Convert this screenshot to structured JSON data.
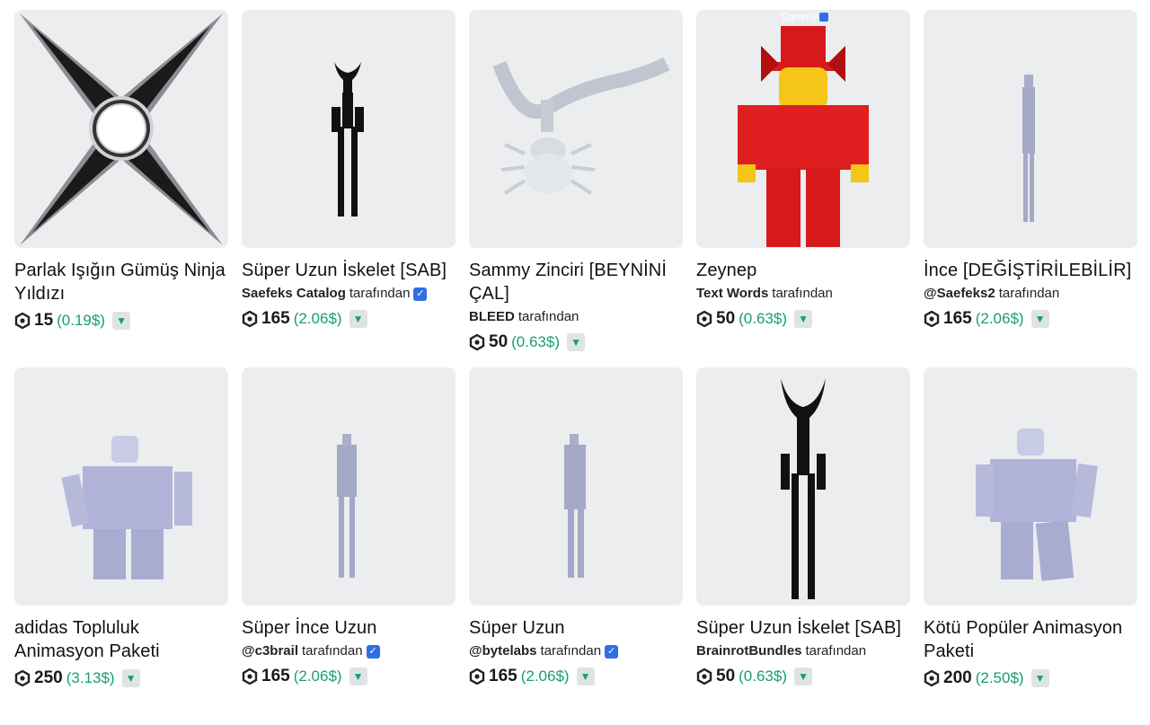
{
  "items": [
    {
      "title": "Parlak Işığın Gümüş Ninja Yıldızı",
      "creator": "",
      "by": "",
      "verified": false,
      "robux": "15",
      "usd": "(0.19$)",
      "icon": "ninja-star-icon"
    },
    {
      "title": "Süper Uzun İskelet [SAB]",
      "creator": "Saefeks Catalog",
      "by": "tarafından",
      "verified": true,
      "robux": "165",
      "usd": "(2.06$)",
      "icon": "tall-skeleton-icon"
    },
    {
      "title": "Sammy Zinciri [BEYNİNİ ÇAL]",
      "creator": "BLEED",
      "by": "tarafından",
      "verified": false,
      "robux": "50",
      "usd": "(0.63$)",
      "icon": "spider-chain-icon"
    },
    {
      "title": "Zeynep",
      "creator": "Text Words",
      "by": "tarafından",
      "verified": false,
      "robux": "50",
      "usd": "(0.63$)",
      "icon": "red-avatar-icon",
      "overlay": "Sammy"
    },
    {
      "title": "İnce [DEĞİŞTİRİLEBİLİR]",
      "creator": "@Saefeks2",
      "by": "tarafından",
      "verified": false,
      "robux": "165",
      "usd": "(2.06$)",
      "icon": "thin-figure-icon"
    },
    {
      "title": "adidas Topluluk Animasyon Paketi",
      "creator": "",
      "by": "",
      "verified": false,
      "robux": "250",
      "usd": "(3.13$)",
      "icon": "avatar-pose-icon"
    },
    {
      "title": "Süper İnce Uzun",
      "creator": "@c3brail",
      "by": "tarafından",
      "verified": true,
      "robux": "165",
      "usd": "(2.06$)",
      "icon": "thin-tall-figure-icon"
    },
    {
      "title": "Süper Uzun",
      "creator": "@bytelabs",
      "by": "tarafından",
      "verified": true,
      "robux": "165",
      "usd": "(2.06$)",
      "icon": "tall-figure-icon"
    },
    {
      "title": "Süper Uzun İskelet [SAB]",
      "creator": "BrainrotBundles",
      "by": "tarafından",
      "verified": false,
      "robux": "50",
      "usd": "(0.63$)",
      "icon": "horned-skeleton-icon"
    },
    {
      "title": "Kötü Popüler Animasyon Paketi",
      "creator": "",
      "by": "",
      "verified": false,
      "robux": "200",
      "usd": "(2.50$)",
      "icon": "avatar-walk-icon"
    }
  ],
  "colors": {
    "card_bg": "#ebedef",
    "usd_green": "#16a06c",
    "verified_blue": "#2f6fe4"
  }
}
